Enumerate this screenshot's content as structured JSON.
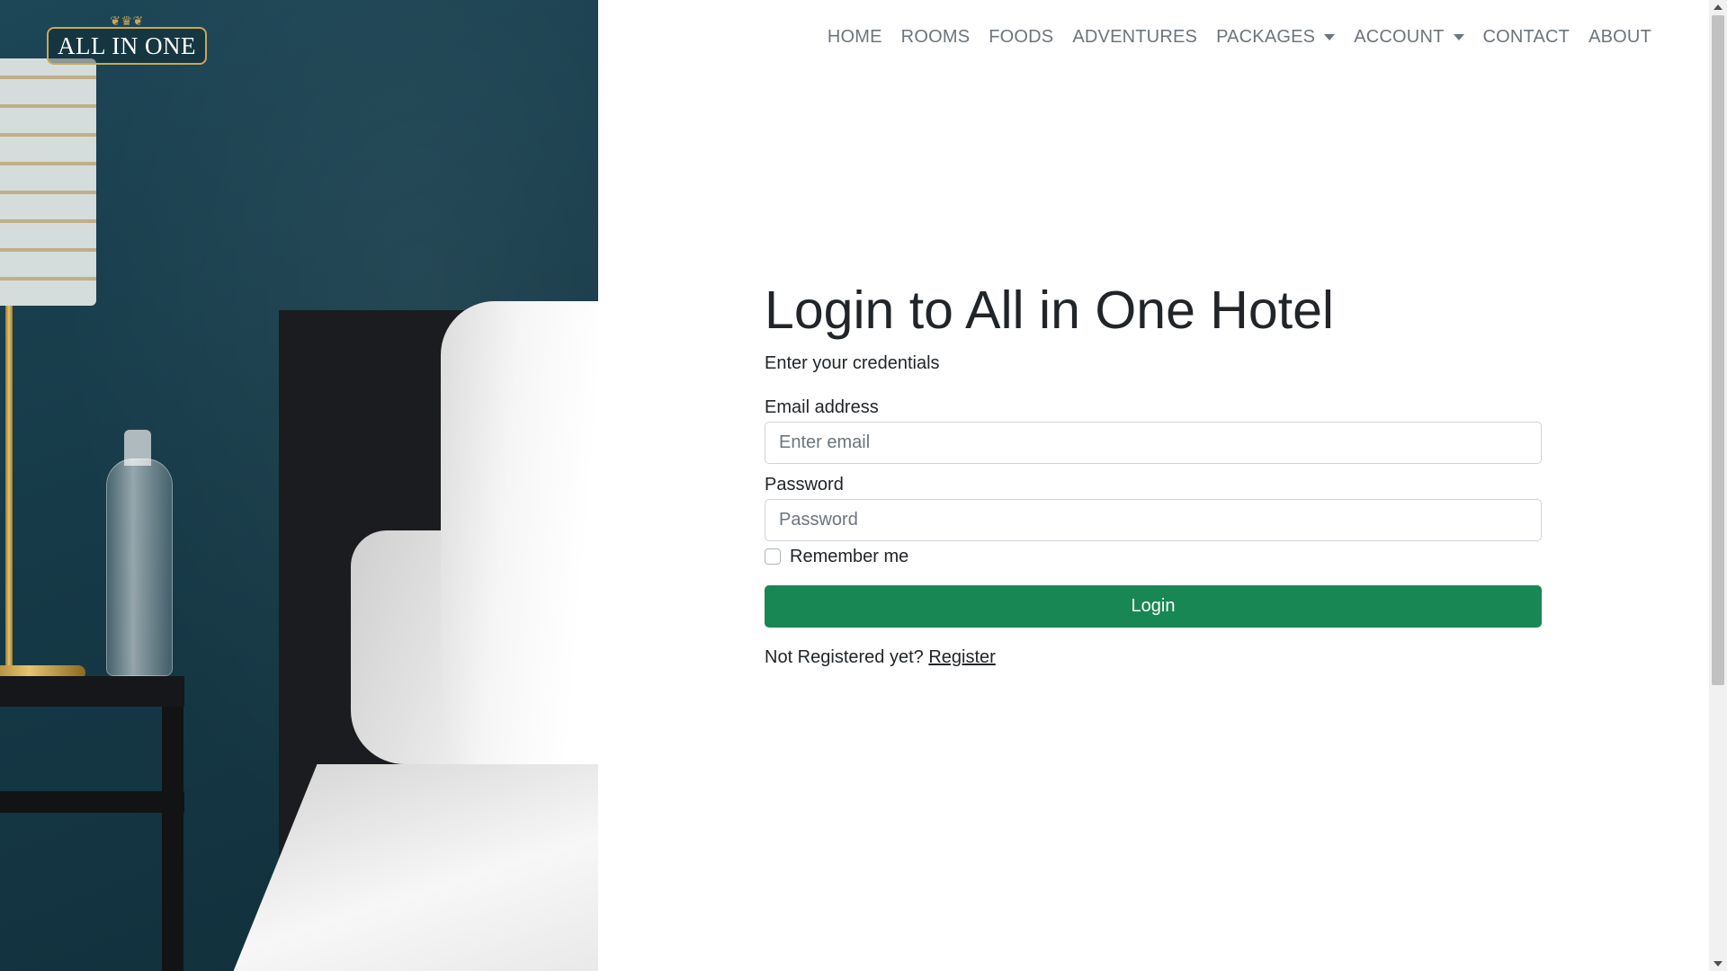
{
  "brand": {
    "logo_text": "ALL IN ONE"
  },
  "nav": {
    "items": [
      {
        "label": "HOME",
        "dropdown": false
      },
      {
        "label": "ROOMS",
        "dropdown": false
      },
      {
        "label": "FOODS",
        "dropdown": false
      },
      {
        "label": "ADVENTURES",
        "dropdown": false
      },
      {
        "label": "PACKAGES",
        "dropdown": true
      },
      {
        "label": "ACCOUNT",
        "dropdown": true
      },
      {
        "label": "CONTACT",
        "dropdown": false
      },
      {
        "label": "ABOUT",
        "dropdown": false
      }
    ]
  },
  "form": {
    "title": "Login to All in One Hotel",
    "subtitle": "Enter your credentials",
    "email_label": "Email address",
    "email_placeholder": "Enter email",
    "email_value": "",
    "password_label": "Password",
    "password_placeholder": "Password",
    "password_value": "",
    "remember_label": "Remember me",
    "remember_checked": false,
    "submit_label": "Login",
    "register_prompt": "Not Registered yet?",
    "register_link": "Register"
  },
  "colors": {
    "primary_button": "#198754",
    "nav_text": "#6c757d",
    "logo_gold": "#c9a75a"
  },
  "icons": {
    "logo_crest": "crown-ornament-icon",
    "dropdown": "caret-down-icon"
  }
}
